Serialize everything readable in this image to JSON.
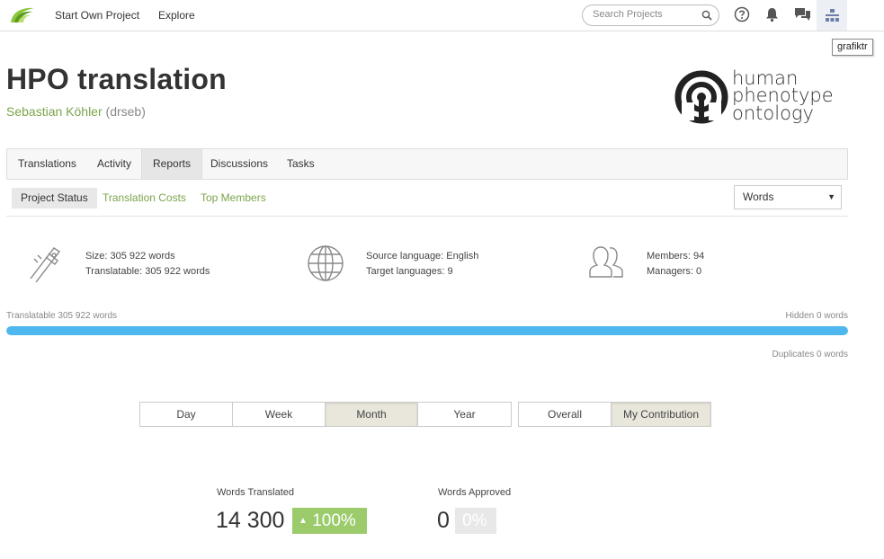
{
  "topbar": {
    "nav": [
      "Start Own Project",
      "Explore"
    ],
    "search_placeholder": "Search Projects",
    "tooltip": "grafiktr",
    "icons": [
      "search-icon",
      "help-icon",
      "bell-icon",
      "chat-icon",
      "user-tree-icon"
    ]
  },
  "project": {
    "title": "HPO translation",
    "owner_name": "Sebastian Köhler",
    "owner_handle": "(drseb)",
    "logo_lines": [
      "human",
      "phenotype",
      "ontology"
    ]
  },
  "tabs": [
    "Translations",
    "Activity",
    "Reports",
    "Discussions",
    "Tasks"
  ],
  "active_tab": "Reports",
  "subtabs": [
    "Project Status",
    "Translation Costs",
    "Top Members"
  ],
  "active_subtab": "Project Status",
  "unit_select": {
    "value": "Words"
  },
  "stats": {
    "size": "Size: 305 922 words",
    "translatable": "Translatable: 305 922 words",
    "source_language": "Source language: English",
    "target_languages": "Target languages: 9",
    "members": "Members: 94",
    "managers": "Managers: 0"
  },
  "progress": {
    "left_label": "Translatable 305 922 words",
    "right_label": "Hidden 0 words",
    "duplicates_label": "Duplicates 0 words",
    "translatable_fraction": 1.0
  },
  "period_buttons": [
    "Day",
    "Week",
    "Month",
    "Year"
  ],
  "active_period": "Month",
  "scope_buttons": [
    "Overall",
    "My Contribution"
  ],
  "active_scope": "My Contribution",
  "metrics": {
    "translated_label": "Words Translated",
    "translated_value": "14 300",
    "translated_change": "100%",
    "approved_label": "Words Approved",
    "approved_value": "0",
    "approved_change": "0%"
  },
  "colors": {
    "accent_green": "#7ba44b",
    "progress_blue": "#4db7ee",
    "badge_green": "#9bcb6b"
  }
}
